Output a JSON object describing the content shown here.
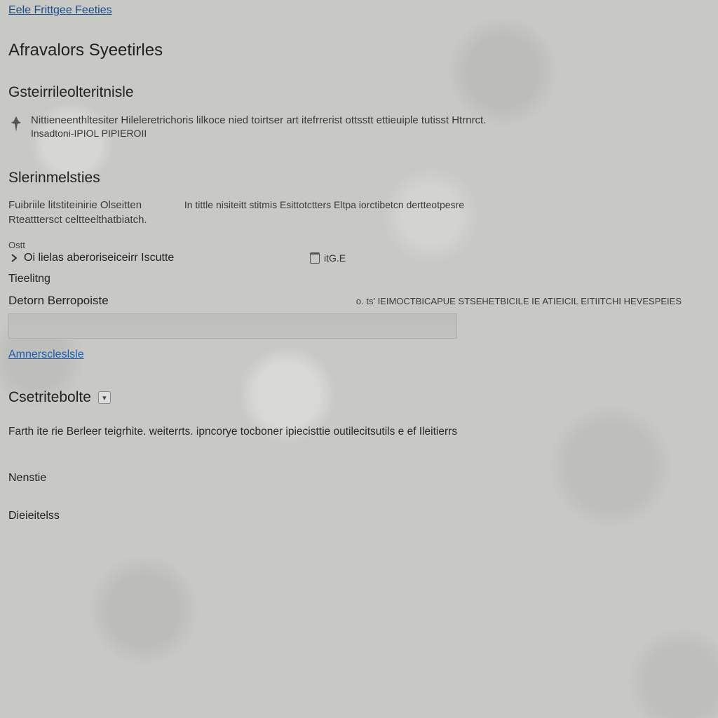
{
  "breadcrumb": "Eele Frittgee Feeties",
  "page_title": "Afravalors Syeetirles",
  "section1": {
    "heading": "Gsteirrileolteritnisle",
    "pin_line1": "Nittieneenthltesiter Hileleretrichoris lilkoce nied toirtser art itefrrerist ottsstt ettieuiple tutisst Htrnrct.",
    "pin_line2": "Insadtoni-IPIOL PIPIEROII"
  },
  "section2": {
    "heading": "Slerinmelsties",
    "desc_line1": "Fuibriile litstiteinirie Olseitten",
    "desc_line2": "Rteatttersct celtteelthatbiatch.",
    "meta_right": "In tittle nisiteitt stitmis Esittotctters Eltpa iorctibetcn dertteotpesre",
    "checkbox_small_label": "Ostt",
    "checkbox_label": "Oi lielas aberoriseiceirr Iscutte",
    "trash_label": "itG.E",
    "field_label": "Tieelitng",
    "date_label": "Detorn Berropoiste",
    "date_hint": "o.  ts' IEIMOCTBICAPUE STSEHETBICILE IE ATIEICIL EITIITCHI HEVESPEIES",
    "link": "Amnerscleslsle"
  },
  "section3": {
    "heading": "Csetritebolte",
    "paragraph": "Farth ite rie Berleer teigrhite. weiterrts. ipncorye tocboner ipiecisttie outilecitsutils e ef Ileitierrs",
    "field1": "Nenstie",
    "field2": "Dieieitelss"
  }
}
